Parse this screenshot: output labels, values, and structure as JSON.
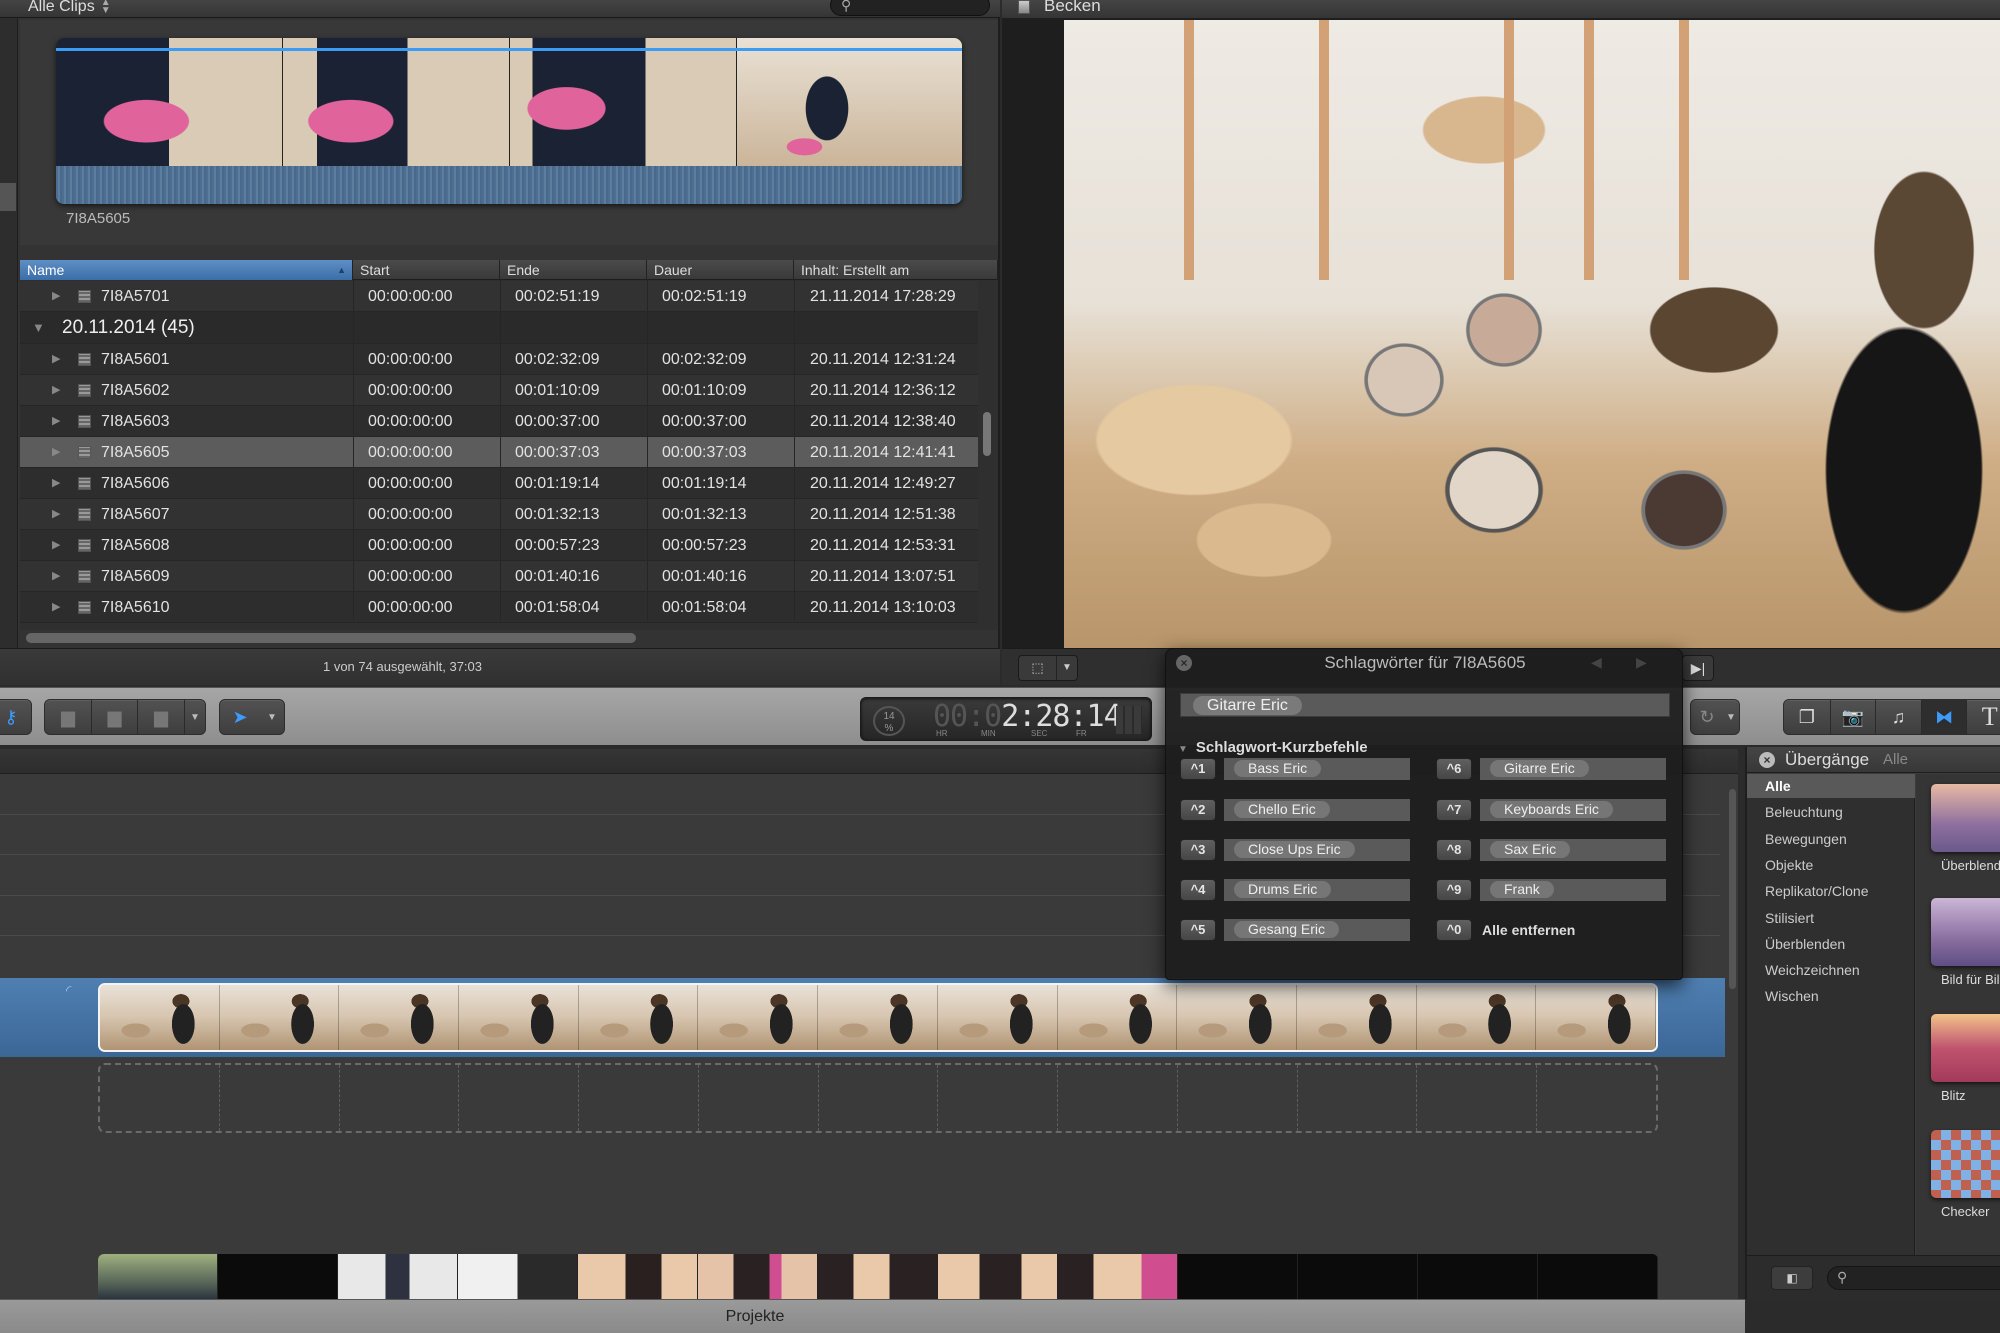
{
  "browser": {
    "filter_label": "Alle Clips",
    "search_placeholder": "",
    "filmstrip_caption": "7I8A5605",
    "columns": [
      "Name",
      "Start",
      "Ende",
      "Dauer",
      "Inhalt: Erstellt am"
    ],
    "rows_before_group": [
      {
        "name": "7I8A5701",
        "start": "00:00:00:00",
        "end": "00:02:51:19",
        "duration": "00:02:51:19",
        "created": "21.11.2014 17:28:29"
      }
    ],
    "group": {
      "title": "20.11.2014",
      "count": "(45)"
    },
    "rows": [
      {
        "name": "7I8A5601",
        "start": "00:00:00:00",
        "end": "00:02:32:09",
        "duration": "00:02:32:09",
        "created": "20.11.2014 12:31:24"
      },
      {
        "name": "7I8A5602",
        "start": "00:00:00:00",
        "end": "00:01:10:09",
        "duration": "00:01:10:09",
        "created": "20.11.2014 12:36:12"
      },
      {
        "name": "7I8A5603",
        "start": "00:00:00:00",
        "end": "00:00:37:00",
        "duration": "00:00:37:00",
        "created": "20.11.2014 12:38:40"
      },
      {
        "name": "7I8A5605",
        "start": "00:00:00:00",
        "end": "00:00:37:03",
        "duration": "00:00:37:03",
        "created": "20.11.2014 12:41:41",
        "selected": true
      },
      {
        "name": "7I8A5606",
        "start": "00:00:00:00",
        "end": "00:01:19:14",
        "duration": "00:01:19:14",
        "created": "20.11.2014 12:49:27"
      },
      {
        "name": "7I8A5607",
        "start": "00:00:00:00",
        "end": "00:01:32:13",
        "duration": "00:01:32:13",
        "created": "20.11.2014 12:51:38"
      },
      {
        "name": "7I8A5608",
        "start": "00:00:00:00",
        "end": "00:00:57:23",
        "duration": "00:00:57:23",
        "created": "20.11.2014 12:53:31"
      },
      {
        "name": "7I8A5609",
        "start": "00:00:00:00",
        "end": "00:01:40:16",
        "duration": "00:01:40:16",
        "created": "20.11.2014 13:07:51"
      },
      {
        "name": "7I8A5610",
        "start": "00:00:00:00",
        "end": "00:01:58:04",
        "duration": "00:01:58:04",
        "created": "20.11.2014 13:10:03"
      }
    ],
    "status": "1 von 74 ausgewählt, 37:03"
  },
  "viewer": {
    "title": "Becken"
  },
  "toolbar": {
    "timecode": {
      "percent": "14",
      "percent_sign": "%",
      "dim_part": "00:0",
      "lit_part": "2:28:14",
      "units": [
        "HR",
        "MIN",
        "SEC",
        "FR"
      ]
    }
  },
  "keyword_hud": {
    "title": "Schlagwörter für 7I8A5605",
    "applied_keywords": [
      "Gitarre Eric"
    ],
    "section_title": "Schlagwort-Kurzbefehle",
    "shortcuts": [
      {
        "key": "^1",
        "keyword": "Bass Eric"
      },
      {
        "key": "^2",
        "keyword": "Chello Eric"
      },
      {
        "key": "^3",
        "keyword": "Close Ups Eric"
      },
      {
        "key": "^4",
        "keyword": "Drums Eric"
      },
      {
        "key": "^5",
        "keyword": "Gesang Eric"
      },
      {
        "key": "^6",
        "keyword": "Gitarre Eric"
      },
      {
        "key": "^7",
        "keyword": "Keyboards Eric"
      },
      {
        "key": "^8",
        "keyword": "Sax Eric"
      },
      {
        "key": "^9",
        "keyword": "Frank"
      }
    ],
    "remove_all": {
      "key": "^0",
      "label": "Alle entfernen"
    }
  },
  "transitions": {
    "title": "Übergänge",
    "filter": "Alle",
    "categories": [
      "Alle",
      "Beleuchtung",
      "Bewegungen",
      "Objekte",
      "Replikator/Clone",
      "Stilisiert",
      "Überblenden",
      "Weichzeichnen",
      "Wischen"
    ],
    "selected_category": "Alle",
    "thumbnails": [
      "Überblenden",
      "Bild für Bild",
      "Blitz",
      "Checker"
    ]
  },
  "project_bar": {
    "label": "Projekte"
  },
  "colors": {
    "accent_blue": "#3d9bff",
    "selection_header": "#4a7fba",
    "timeline_band": "#4a79ab"
  }
}
